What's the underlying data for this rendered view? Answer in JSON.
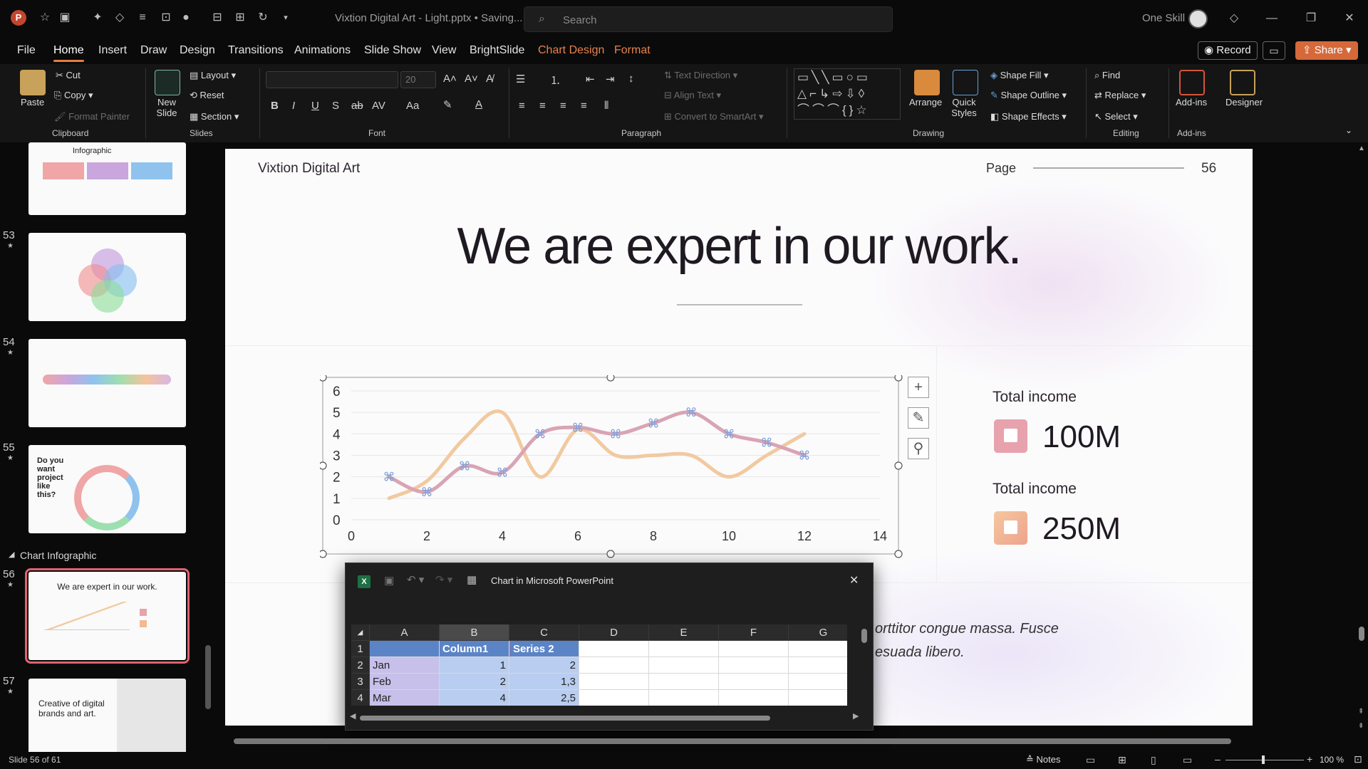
{
  "titlebar": {
    "doc_title": "Vixtion Digital Art - Light.pptx • Saving...",
    "search_placeholder": "Search",
    "user_name": "One Skill"
  },
  "menu": {
    "items": [
      "File",
      "Home",
      "Insert",
      "Draw",
      "Design",
      "Transitions",
      "Animations",
      "Slide Show",
      "View",
      "BrightSlide"
    ],
    "contextual": [
      "Chart Design",
      "Format"
    ],
    "active": "Home",
    "record": "Record",
    "share": "Share"
  },
  "ribbon": {
    "clipboard": {
      "label": "Clipboard",
      "paste": "Paste",
      "cut": "Cut",
      "copy": "Copy",
      "format_painter": "Format Painter"
    },
    "slides": {
      "label": "Slides",
      "new_slide": "New Slide",
      "layout": "Layout",
      "reset": "Reset",
      "section": "Section"
    },
    "font": {
      "label": "Font",
      "size": "20"
    },
    "paragraph": {
      "label": "Paragraph",
      "text_direction": "Text Direction",
      "align_text": "Align Text",
      "smartart": "Convert to SmartArt"
    },
    "drawing": {
      "label": "Drawing",
      "arrange": "Arrange",
      "quick_styles": "Quick Styles",
      "shape_fill": "Shape Fill",
      "shape_outline": "Shape Outline",
      "shape_effects": "Shape Effects"
    },
    "editing": {
      "label": "Editing",
      "find": "Find",
      "replace": "Replace",
      "select": "Select"
    },
    "addins": {
      "label": "Add-ins",
      "addins": "Add-ins",
      "designer": "Designer"
    }
  },
  "thumbnails": {
    "section": "Chart Infographic",
    "items": [
      {
        "num": "",
        "title": "Infographic"
      },
      {
        "num": "53",
        "title": ""
      },
      {
        "num": "54",
        "title": ""
      },
      {
        "num": "55",
        "title": "Do you want project like this?"
      },
      {
        "num": "56",
        "title": "We are expert in our work."
      },
      {
        "num": "57",
        "title": "Creative of digital brands and art."
      }
    ]
  },
  "slide": {
    "brand": "Vixtion Digital Art",
    "page_label": "Page",
    "page_number": "56",
    "title": "We are expert in our work.",
    "incomes": [
      {
        "label": "Total income",
        "value": "100M",
        "color": "#e7a2ad"
      },
      {
        "label": "Total income",
        "value": "250M",
        "color": "#f2b992"
      }
    ],
    "body_line1": "orttitor congue massa. Fusce",
    "body_line2": "esuada libero."
  },
  "chart_data": {
    "type": "scatter",
    "xlim": [
      0,
      14
    ],
    "ylim": [
      0,
      6
    ],
    "x_ticks": [
      "0",
      "2",
      "4",
      "6",
      "8",
      "10",
      "12",
      "14"
    ],
    "y_ticks": [
      "0",
      "1",
      "2",
      "3",
      "4",
      "5",
      "6"
    ],
    "series": [
      {
        "color": "#d9a4b4",
        "x": [
          1,
          2,
          3,
          4,
          5,
          6,
          7,
          8,
          9,
          10,
          11,
          12
        ],
        "y": [
          2,
          1.3,
          2.5,
          2.2,
          4,
          4.3,
          4,
          4.5,
          5,
          4,
          3.6,
          3
        ]
      },
      {
        "color": "#f2c9a0",
        "x": [
          1,
          2,
          3,
          4,
          5,
          6,
          7,
          8,
          9,
          10,
          11,
          12
        ],
        "y": [
          1,
          1.8,
          3.8,
          5,
          2,
          4.2,
          3,
          3,
          3,
          2,
          3,
          4
        ]
      }
    ]
  },
  "excel": {
    "title": "Chart in Microsoft PowerPoint",
    "columns": [
      "A",
      "B",
      "C",
      "D",
      "E",
      "F",
      "G"
    ],
    "rows": [
      {
        "n": "1",
        "a": "",
        "b": "Column1",
        "c": "Series 2"
      },
      {
        "n": "2",
        "a": "Jan",
        "b": "1",
        "c": "2"
      },
      {
        "n": "3",
        "a": "Feb",
        "b": "2",
        "c": "1,3"
      },
      {
        "n": "4",
        "a": "Mar",
        "b": "4",
        "c": "2,5"
      }
    ]
  },
  "status": {
    "slide_count": "Slide 56 of 61",
    "notes": "Notes",
    "zoom": "100 %"
  }
}
